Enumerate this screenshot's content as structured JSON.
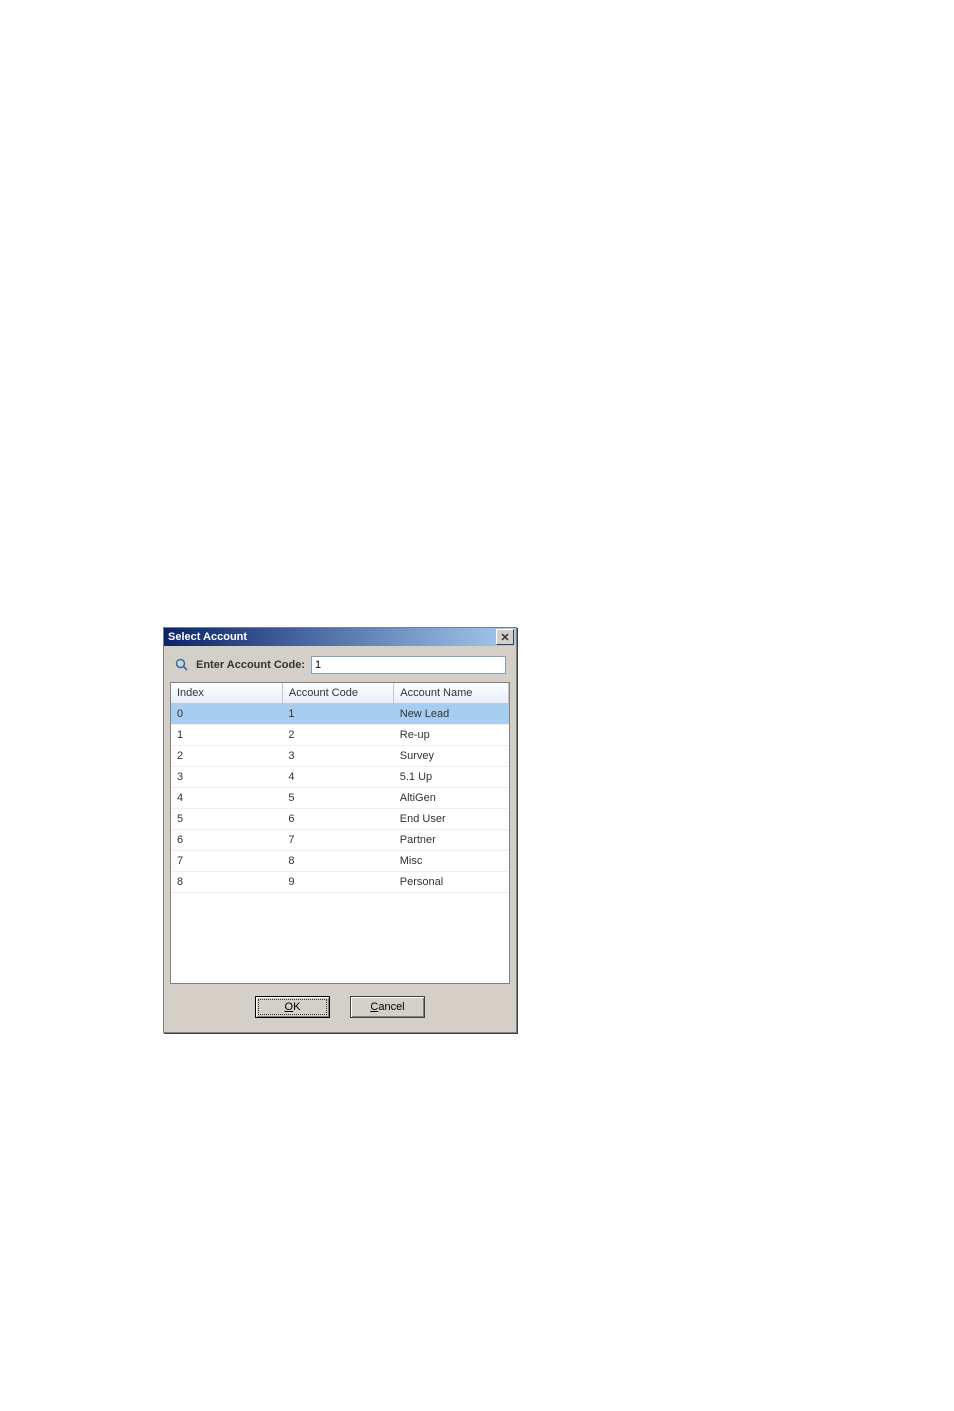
{
  "dialog": {
    "title": "Select Account",
    "search_label": "Enter Account Code:",
    "search_value": "1",
    "table": {
      "headers": {
        "index": "Index",
        "code": "Account Code",
        "name": "Account Name"
      },
      "rows": [
        {
          "index": "0",
          "code": "1",
          "name": "New Lead",
          "selected": true
        },
        {
          "index": "1",
          "code": "2",
          "name": "Re-up"
        },
        {
          "index": "2",
          "code": "3",
          "name": "Survey"
        },
        {
          "index": "3",
          "code": "4",
          "name": "5.1 Up"
        },
        {
          "index": "4",
          "code": "5",
          "name": "AltiGen"
        },
        {
          "index": "5",
          "code": "6",
          "name": "End User"
        },
        {
          "index": "6",
          "code": "7",
          "name": "Partner"
        },
        {
          "index": "7",
          "code": "8",
          "name": "Misc"
        },
        {
          "index": "8",
          "code": "9",
          "name": "Personal"
        }
      ]
    },
    "buttons": {
      "ok_prefix": "O",
      "ok_rest": "K",
      "cancel_prefix": "C",
      "cancel_rest": "ancel"
    }
  }
}
